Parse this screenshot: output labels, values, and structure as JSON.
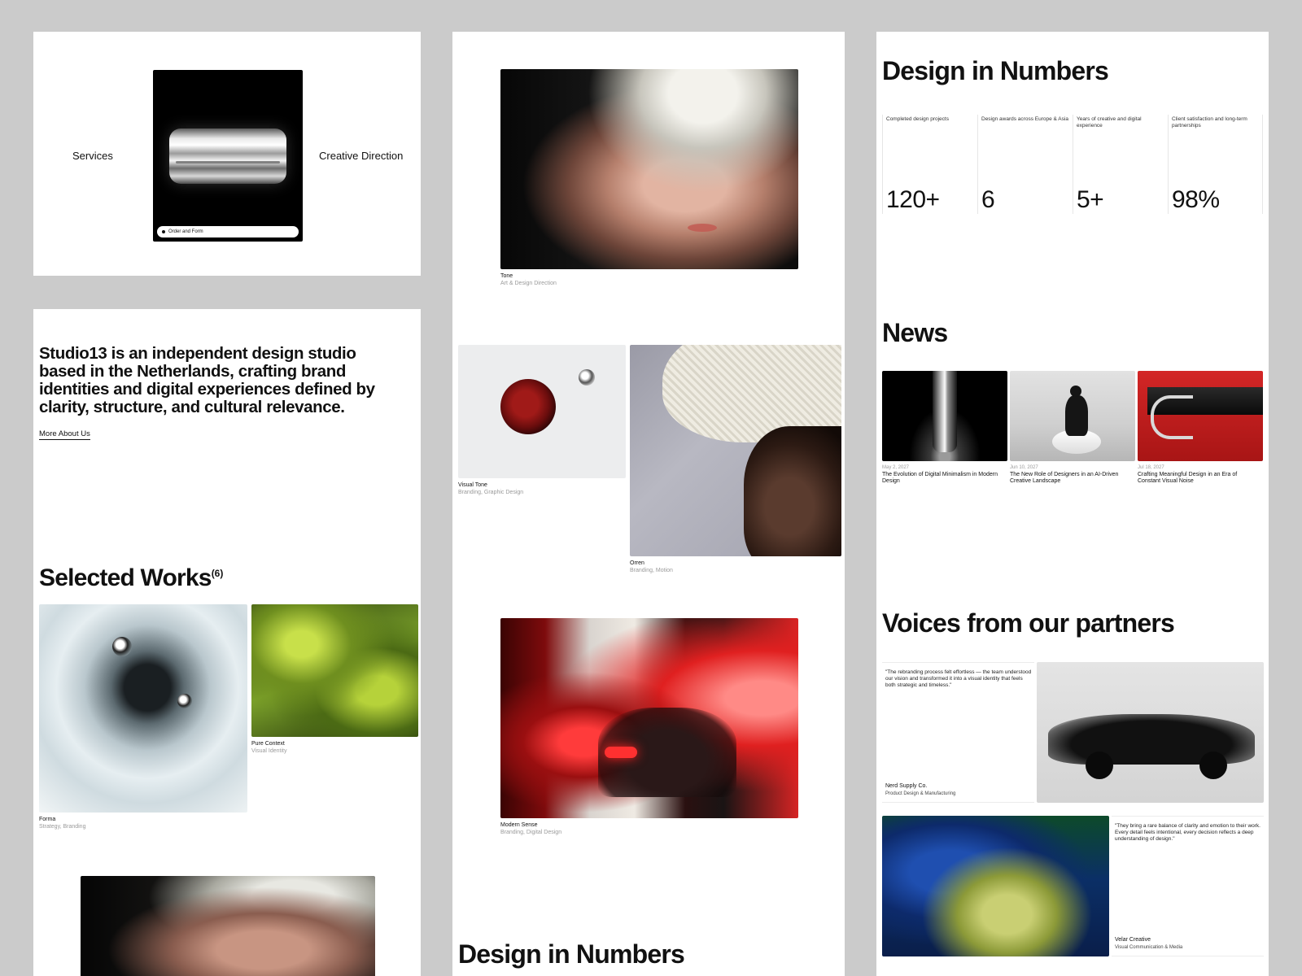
{
  "hero": {
    "services_label": "Services",
    "creative_label": "Creative Direction",
    "order_label": "Order and Form"
  },
  "about": {
    "text": "Studio13 is an independent design studio based in the Netherlands, crafting brand identities and digital experiences defined by clarity, structure, and cultural relevance.",
    "link": "More About Us"
  },
  "works": {
    "title": "Selected Works",
    "count": "(6)",
    "items": [
      {
        "title": "Forma",
        "sub": "Strategy, Branding"
      },
      {
        "title": "Pure Context",
        "sub": "Visual Identity"
      },
      {
        "title": "Tone",
        "sub": "Art & Design Direction"
      },
      {
        "title": "Visual Tone",
        "sub": "Branding, Graphic Design"
      },
      {
        "title": "Orren",
        "sub": "Branding, Motion"
      },
      {
        "title": "Modern Sense",
        "sub": "Branding, Digital Design"
      }
    ]
  },
  "numbers": {
    "title": "Design in Numbers",
    "stats": [
      {
        "label": "Completed design projects",
        "value": "120+"
      },
      {
        "label": "Design awards across Europe & Asia",
        "value": "6"
      },
      {
        "label": "Years of creative and digital experience",
        "value": "5+"
      },
      {
        "label": "Client satisfaction and long-term partnerships",
        "value": "98%"
      }
    ]
  },
  "news": {
    "title": "News",
    "items": [
      {
        "date": "May 2, 2027",
        "title": "The Evolution of Digital Minimalism in Modern Design"
      },
      {
        "date": "Jun 10, 2027",
        "title": "The New Role of Designers in an AI-Driven Creative Landscape"
      },
      {
        "date": "Jul 18, 2027",
        "title": "Crafting Meaningful Design in an Era of Constant Visual Noise"
      }
    ]
  },
  "voices": {
    "title": "Voices from our partners",
    "items": [
      {
        "quote": "\"The rebranding process felt effortless — the team understood our vision and transformed it into a visual identity that feels both strategic and timeless.\"",
        "name": "Nerd Supply Co.",
        "role": "Product Design & Manufacturing"
      },
      {
        "quote": "\"They bring a rare balance of clarity and emotion to their work. Every detail feels intentional, every decision reflects a deep understanding of design.\"",
        "name": "Velar Creative",
        "role": "Visual Communication & Media"
      }
    ]
  }
}
